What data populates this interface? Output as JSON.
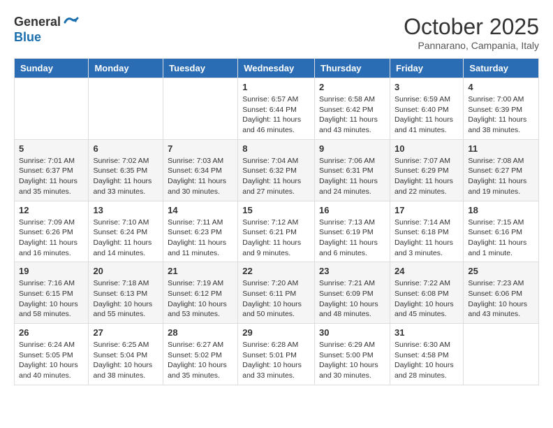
{
  "logo": {
    "general": "General",
    "blue": "Blue"
  },
  "title": "October 2025",
  "subtitle": "Pannarano, Campania, Italy",
  "days_of_week": [
    "Sunday",
    "Monday",
    "Tuesday",
    "Wednesday",
    "Thursday",
    "Friday",
    "Saturday"
  ],
  "weeks": [
    [
      {
        "day": "",
        "info": ""
      },
      {
        "day": "",
        "info": ""
      },
      {
        "day": "",
        "info": ""
      },
      {
        "day": "1",
        "info": "Sunrise: 6:57 AM\nSunset: 6:44 PM\nDaylight: 11 hours and 46 minutes."
      },
      {
        "day": "2",
        "info": "Sunrise: 6:58 AM\nSunset: 6:42 PM\nDaylight: 11 hours and 43 minutes."
      },
      {
        "day": "3",
        "info": "Sunrise: 6:59 AM\nSunset: 6:40 PM\nDaylight: 11 hours and 41 minutes."
      },
      {
        "day": "4",
        "info": "Sunrise: 7:00 AM\nSunset: 6:39 PM\nDaylight: 11 hours and 38 minutes."
      }
    ],
    [
      {
        "day": "5",
        "info": "Sunrise: 7:01 AM\nSunset: 6:37 PM\nDaylight: 11 hours and 35 minutes."
      },
      {
        "day": "6",
        "info": "Sunrise: 7:02 AM\nSunset: 6:35 PM\nDaylight: 11 hours and 33 minutes."
      },
      {
        "day": "7",
        "info": "Sunrise: 7:03 AM\nSunset: 6:34 PM\nDaylight: 11 hours and 30 minutes."
      },
      {
        "day": "8",
        "info": "Sunrise: 7:04 AM\nSunset: 6:32 PM\nDaylight: 11 hours and 27 minutes."
      },
      {
        "day": "9",
        "info": "Sunrise: 7:06 AM\nSunset: 6:31 PM\nDaylight: 11 hours and 24 minutes."
      },
      {
        "day": "10",
        "info": "Sunrise: 7:07 AM\nSunset: 6:29 PM\nDaylight: 11 hours and 22 minutes."
      },
      {
        "day": "11",
        "info": "Sunrise: 7:08 AM\nSunset: 6:27 PM\nDaylight: 11 hours and 19 minutes."
      }
    ],
    [
      {
        "day": "12",
        "info": "Sunrise: 7:09 AM\nSunset: 6:26 PM\nDaylight: 11 hours and 16 minutes."
      },
      {
        "day": "13",
        "info": "Sunrise: 7:10 AM\nSunset: 6:24 PM\nDaylight: 11 hours and 14 minutes."
      },
      {
        "day": "14",
        "info": "Sunrise: 7:11 AM\nSunset: 6:23 PM\nDaylight: 11 hours and 11 minutes."
      },
      {
        "day": "15",
        "info": "Sunrise: 7:12 AM\nSunset: 6:21 PM\nDaylight: 11 hours and 9 minutes."
      },
      {
        "day": "16",
        "info": "Sunrise: 7:13 AM\nSunset: 6:19 PM\nDaylight: 11 hours and 6 minutes."
      },
      {
        "day": "17",
        "info": "Sunrise: 7:14 AM\nSunset: 6:18 PM\nDaylight: 11 hours and 3 minutes."
      },
      {
        "day": "18",
        "info": "Sunrise: 7:15 AM\nSunset: 6:16 PM\nDaylight: 11 hours and 1 minute."
      }
    ],
    [
      {
        "day": "19",
        "info": "Sunrise: 7:16 AM\nSunset: 6:15 PM\nDaylight: 10 hours and 58 minutes."
      },
      {
        "day": "20",
        "info": "Sunrise: 7:18 AM\nSunset: 6:13 PM\nDaylight: 10 hours and 55 minutes."
      },
      {
        "day": "21",
        "info": "Sunrise: 7:19 AM\nSunset: 6:12 PM\nDaylight: 10 hours and 53 minutes."
      },
      {
        "day": "22",
        "info": "Sunrise: 7:20 AM\nSunset: 6:11 PM\nDaylight: 10 hours and 50 minutes."
      },
      {
        "day": "23",
        "info": "Sunrise: 7:21 AM\nSunset: 6:09 PM\nDaylight: 10 hours and 48 minutes."
      },
      {
        "day": "24",
        "info": "Sunrise: 7:22 AM\nSunset: 6:08 PM\nDaylight: 10 hours and 45 minutes."
      },
      {
        "day": "25",
        "info": "Sunrise: 7:23 AM\nSunset: 6:06 PM\nDaylight: 10 hours and 43 minutes."
      }
    ],
    [
      {
        "day": "26",
        "info": "Sunrise: 6:24 AM\nSunset: 5:05 PM\nDaylight: 10 hours and 40 minutes."
      },
      {
        "day": "27",
        "info": "Sunrise: 6:25 AM\nSunset: 5:04 PM\nDaylight: 10 hours and 38 minutes."
      },
      {
        "day": "28",
        "info": "Sunrise: 6:27 AM\nSunset: 5:02 PM\nDaylight: 10 hours and 35 minutes."
      },
      {
        "day": "29",
        "info": "Sunrise: 6:28 AM\nSunset: 5:01 PM\nDaylight: 10 hours and 33 minutes."
      },
      {
        "day": "30",
        "info": "Sunrise: 6:29 AM\nSunset: 5:00 PM\nDaylight: 10 hours and 30 minutes."
      },
      {
        "day": "31",
        "info": "Sunrise: 6:30 AM\nSunset: 4:58 PM\nDaylight: 10 hours and 28 minutes."
      },
      {
        "day": "",
        "info": ""
      }
    ]
  ]
}
